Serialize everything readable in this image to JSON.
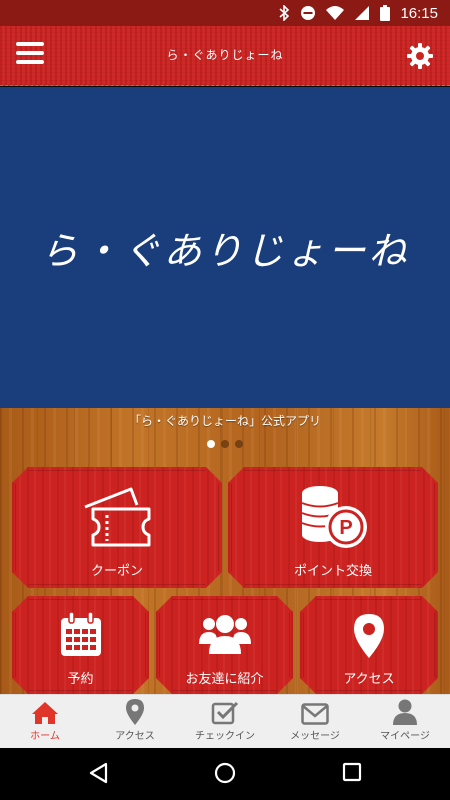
{
  "status_bar": {
    "time": "16:15"
  },
  "header": {
    "title": "ら・ぐありじょーね"
  },
  "hero": {
    "logo_text": "ら・ぐありじょーね"
  },
  "caption": "「ら・ぐありじょーね」公式アプリ",
  "carousel": {
    "pages": 3,
    "active": 1
  },
  "tiles": [
    {
      "label": "クーポン",
      "icon": "ticket-icon"
    },
    {
      "label": "ポイント交換",
      "icon": "coins-point-icon"
    },
    {
      "label": "予約",
      "icon": "calendar-icon"
    },
    {
      "label": "お友達に紹介",
      "icon": "users-icon"
    },
    {
      "label": "アクセス",
      "icon": "map-pin-icon"
    }
  ],
  "bottom_nav": [
    {
      "label": "ホーム",
      "icon": "home-icon",
      "active": true
    },
    {
      "label": "アクセス",
      "icon": "map-pin-icon"
    },
    {
      "label": "チェックイン",
      "icon": "checkin-icon"
    },
    {
      "label": "メッセージ",
      "icon": "envelope-icon"
    },
    {
      "label": "マイページ",
      "icon": "user-icon"
    }
  ],
  "colors": {
    "header_red": "#cc2220",
    "hero_blue": "#1a3d7b",
    "active_nav": "#e0362a"
  }
}
